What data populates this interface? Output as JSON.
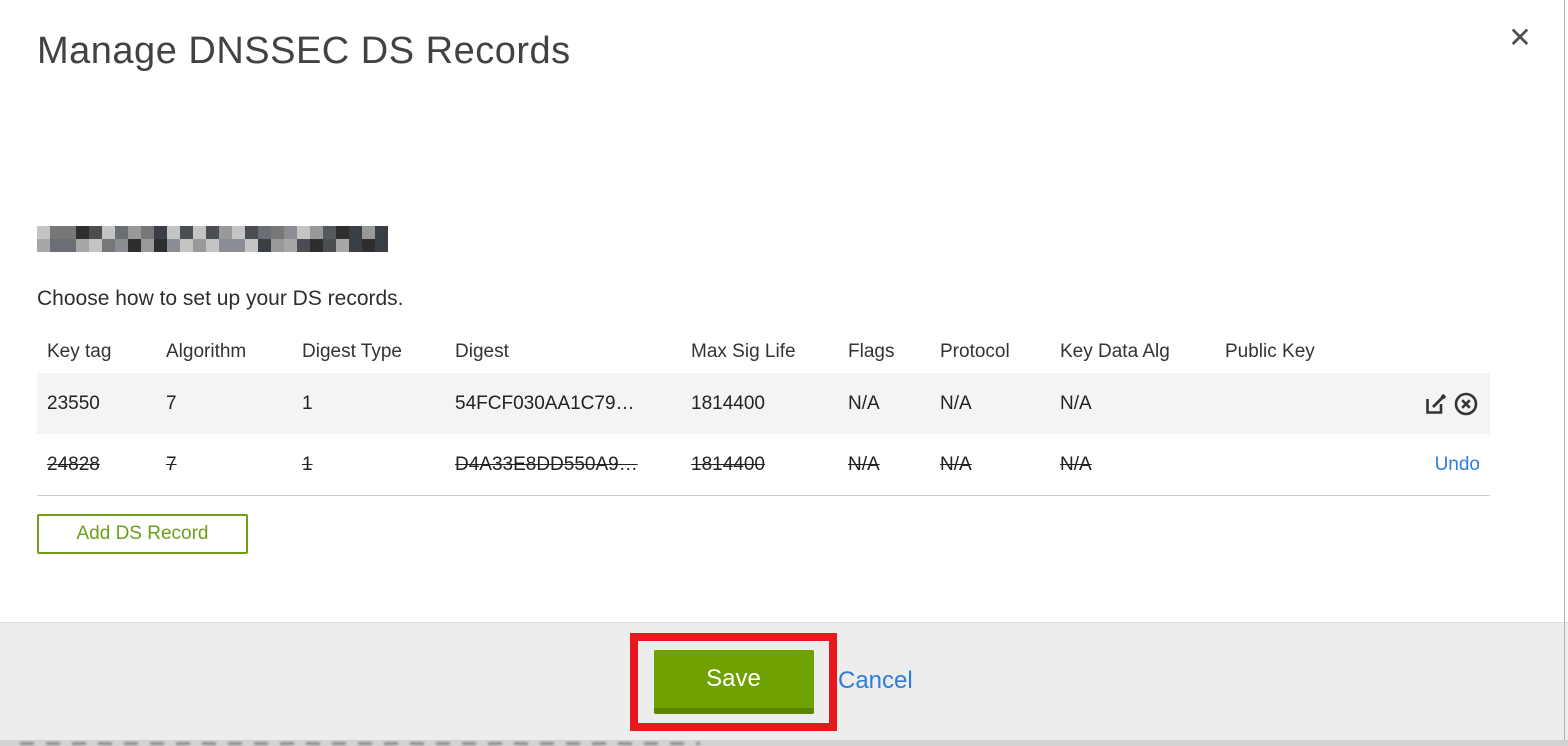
{
  "modal": {
    "title": "Manage DNSSEC DS Records",
    "close_label": "✕",
    "instruction": "Choose how to set up your DS records.",
    "add_button_label": "Add DS Record",
    "save_label": "Save",
    "cancel_label": "Cancel",
    "undo_label": "Undo"
  },
  "table": {
    "headers": {
      "key_tag": "Key tag",
      "algorithm": "Algorithm",
      "digest_type": "Digest Type",
      "digest": "Digest",
      "max_sig_life": "Max Sig Life",
      "flags": "Flags",
      "protocol": "Protocol",
      "key_data_alg": "Key Data Alg",
      "public_key": "Public Key"
    },
    "rows": [
      {
        "key_tag": "23550",
        "algorithm": "7",
        "digest_type": "1",
        "digest": "54FCF030AA1C79…",
        "max_sig_life": "1814400",
        "flags": "N/A",
        "protocol": "N/A",
        "key_data_alg": "N/A",
        "public_key": "",
        "state": "normal"
      },
      {
        "key_tag": "24828",
        "algorithm": "7",
        "digest_type": "1",
        "digest": "D4A33E8DD550A9…",
        "max_sig_life": "1814400",
        "flags": "N/A",
        "protocol": "N/A",
        "key_data_alg": "N/A",
        "public_key": "",
        "state": "deleted"
      }
    ]
  },
  "colors": {
    "accent_green": "#6e9e19",
    "save_green": "#6fa100",
    "save_green_dark": "#5a8400",
    "link_blue": "#2f7cdb",
    "annotation_red": "#e8191c",
    "row_gray": "#f4f4f4",
    "footer_gray": "#ededed"
  }
}
